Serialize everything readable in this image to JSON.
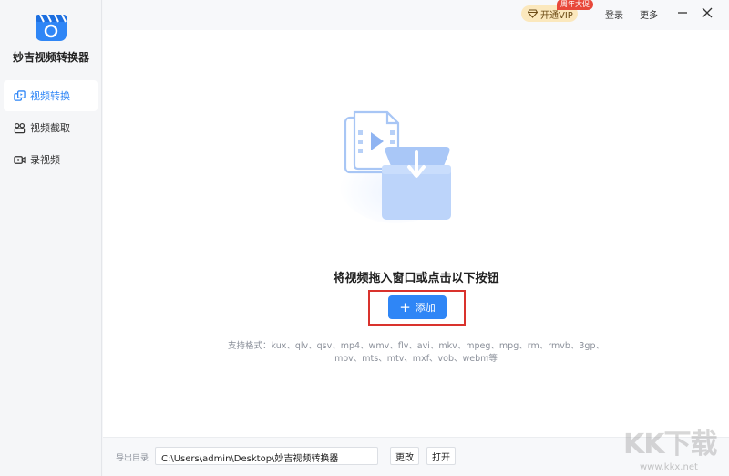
{
  "app": {
    "title": "妙吉视频转换器"
  },
  "sidebar": {
    "items": [
      {
        "label": "视频转换",
        "icon": "video-convert-icon",
        "active": true
      },
      {
        "label": "视频截取",
        "icon": "video-clip-icon",
        "active": false
      },
      {
        "label": "录视频",
        "icon": "record-video-icon",
        "active": false
      }
    ]
  },
  "topbar": {
    "vip_label": "开通VIP",
    "vip_badge": "周年大促",
    "login_label": "登录",
    "more_label": "更多"
  },
  "drop": {
    "title": "将视频拖入窗口或点击以下按钮",
    "add_label": "添加",
    "formats_line1": "支持格式：kux、qlv、qsv、mp4、wmv、flv、avi、mkv、mpeg、mpg、rm、rmvb、3gp、",
    "formats_line2": "mov、mts、mtv、mxf、vob、webm等"
  },
  "bottom": {
    "output_label": "导出目录",
    "output_path": "C:\\Users\\admin\\Desktop\\妙吉视频转换器",
    "change_label": "更改",
    "open_label": "打开"
  },
  "watermark": {
    "text": "KK下载",
    "url": "www.kkx.net"
  },
  "colors": {
    "accent": "#2f86f6",
    "highlight": "#d9322d",
    "vip_bg": "#fbe8bd",
    "badge": "#e8483a"
  }
}
